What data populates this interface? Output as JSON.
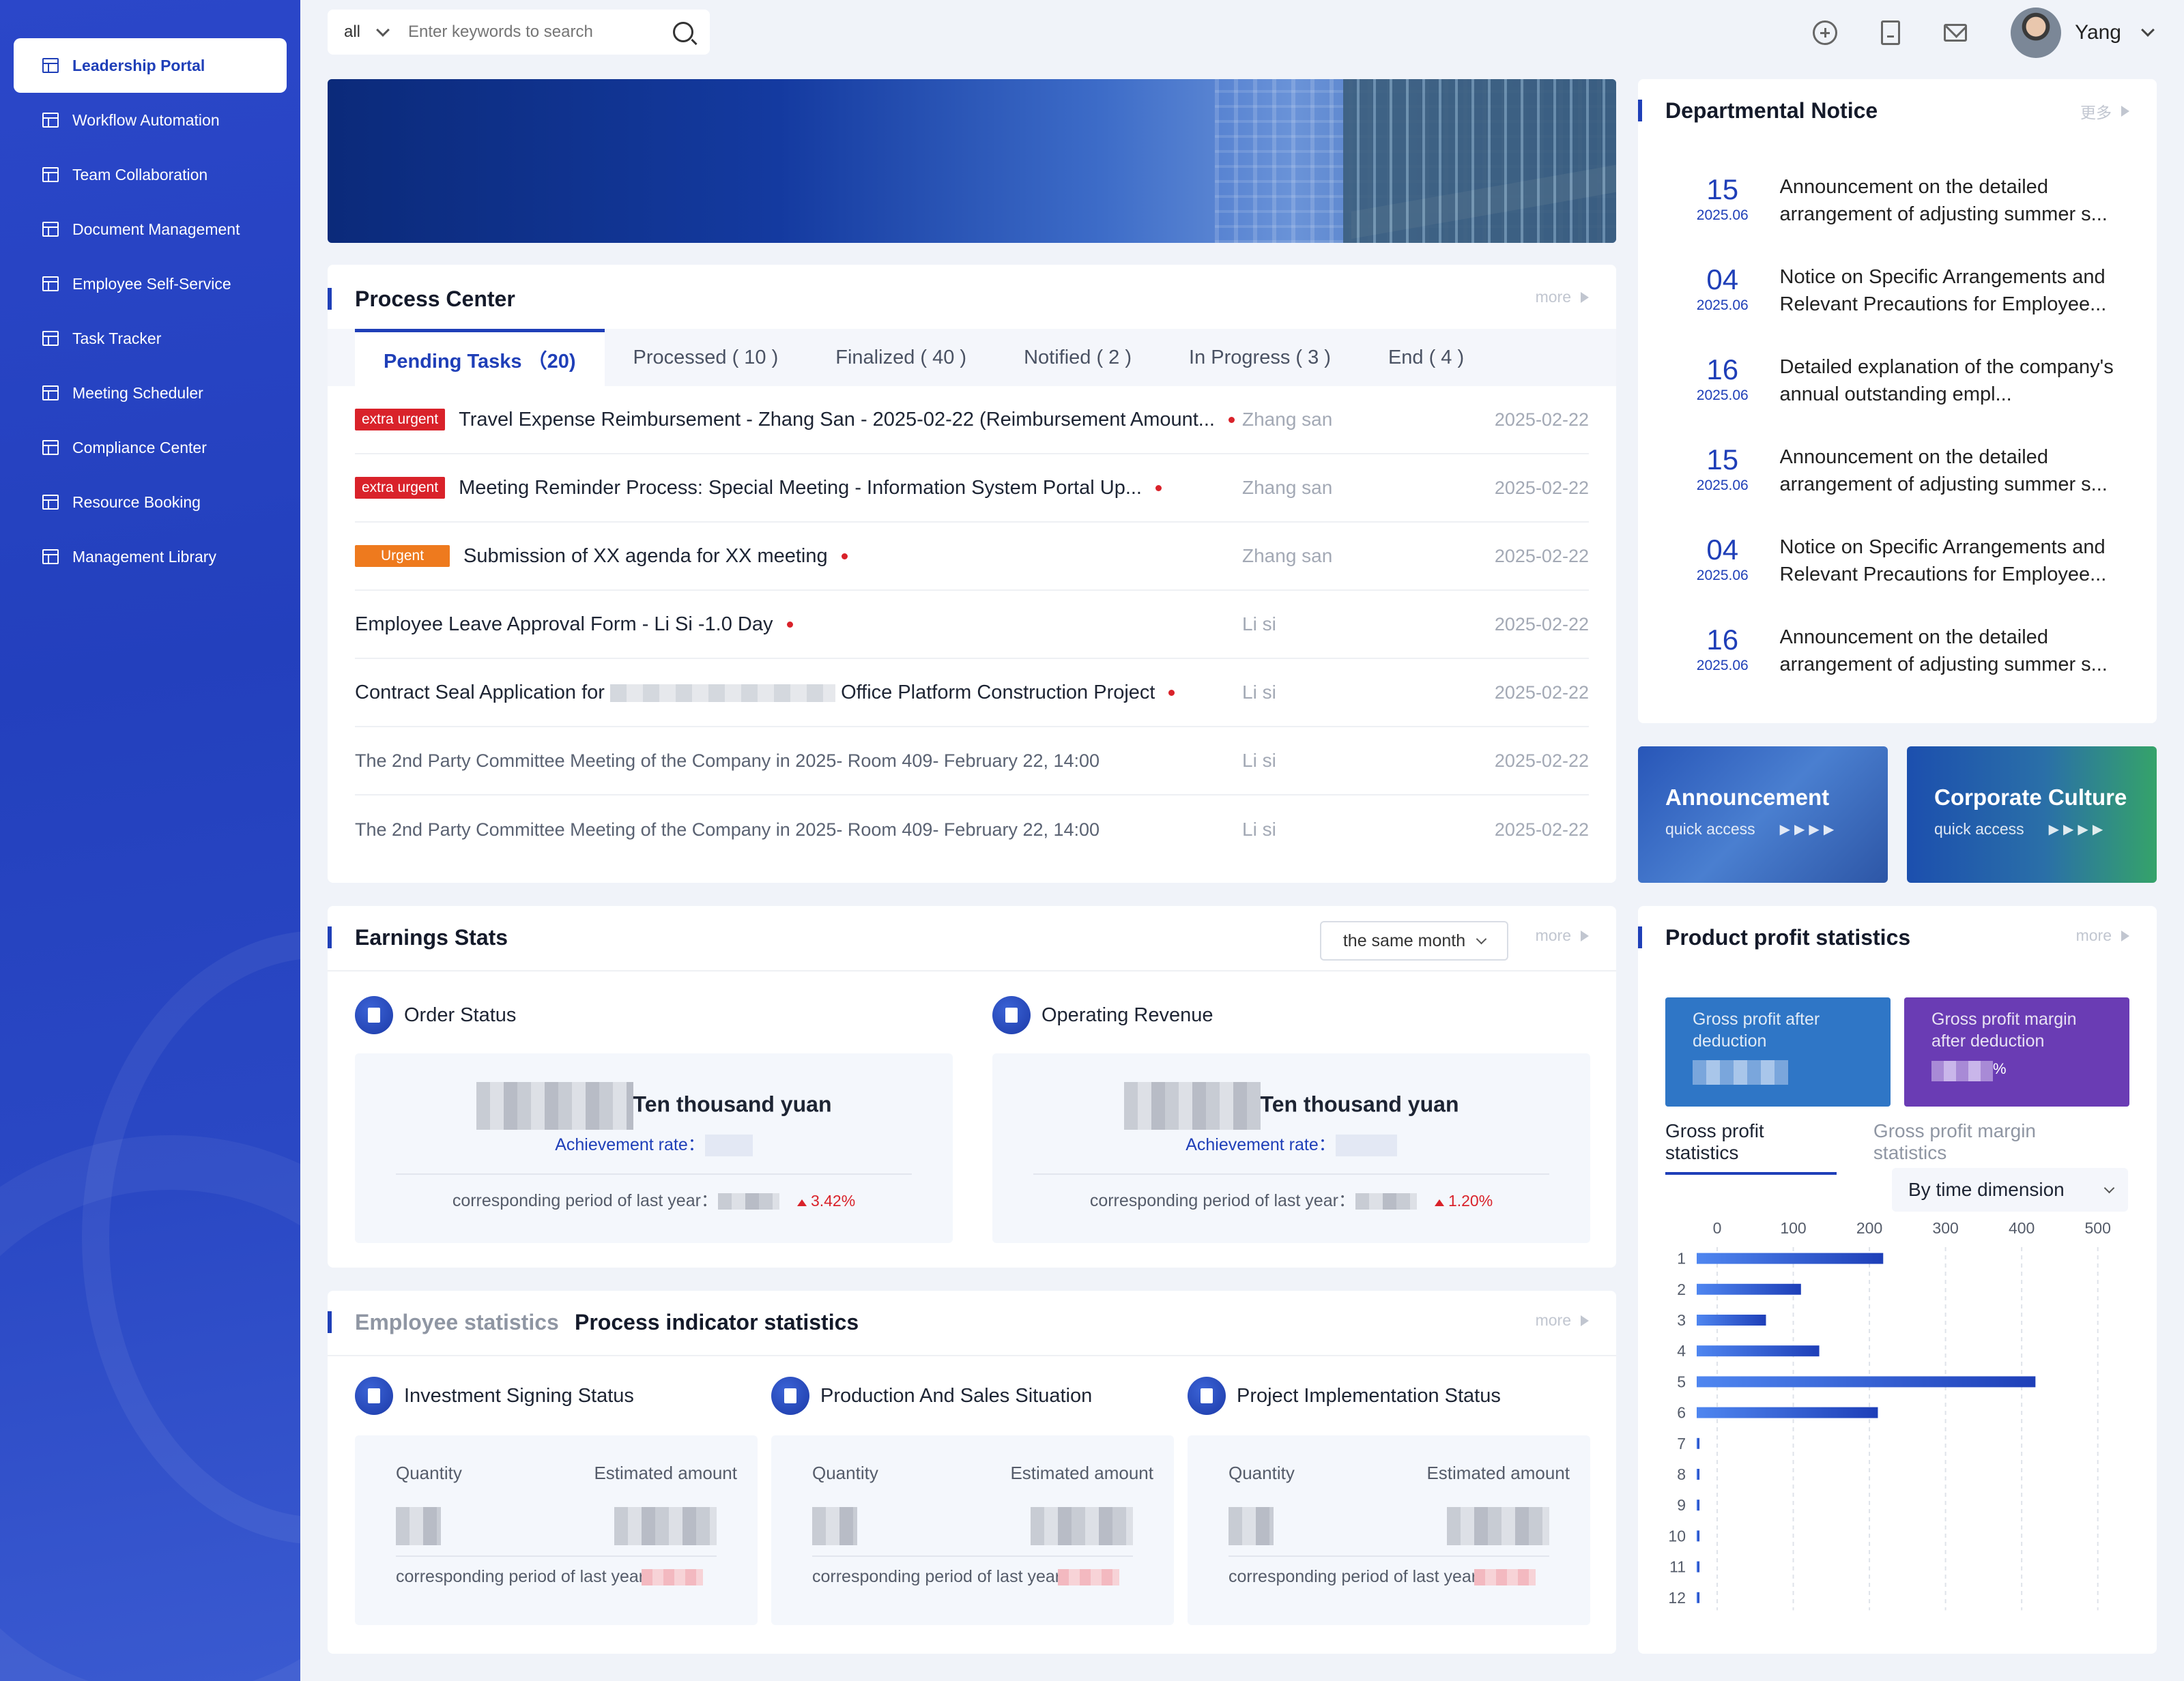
{
  "sidebar": {
    "items": [
      {
        "label": "Leadership Portal",
        "active": true
      },
      {
        "label": "Workflow Automation"
      },
      {
        "label": "Team Collaboration"
      },
      {
        "label": "Document Management"
      },
      {
        "label": "Employee Self-Service"
      },
      {
        "label": "Task Tracker"
      },
      {
        "label": "Meeting Scheduler"
      },
      {
        "label": "Compliance Center"
      },
      {
        "label": "Resource Booking"
      },
      {
        "label": "Management Library"
      }
    ]
  },
  "search": {
    "scope": "all",
    "placeholder": "Enter keywords to search"
  },
  "user": {
    "name": "Yang"
  },
  "icons": {
    "add": "plus-circle-icon",
    "document": "document-icon",
    "mail": "mail-icon",
    "search": "search-icon"
  },
  "process_center": {
    "title": "Process Center",
    "more": "more",
    "tabs": [
      {
        "label": "Pending Tasks （20)",
        "active": true
      },
      {
        "label": "Processed ( 10 )"
      },
      {
        "label": "Finalized ( 40 )"
      },
      {
        "label": "Notified ( 2 )"
      },
      {
        "label": "In Progress ( 3 )"
      },
      {
        "label": "End ( 4 )"
      }
    ],
    "tasks": [
      {
        "badge": "extra urgent",
        "badge_color": "#d9222a",
        "title": "Travel Expense Reimbursement - Zhang San - 2025-02-22 (Reimbursement Amount...",
        "dot": true,
        "user": "Zhang san",
        "date": "2025-02-22"
      },
      {
        "badge": "extra urgent",
        "badge_color": "#d9222a",
        "title": "Meeting Reminder Process: Special Meeting - Information System Portal Up...",
        "dot": true,
        "user": "Zhang san",
        "date": "2025-02-22"
      },
      {
        "badge": "Urgent",
        "badge_color": "#ee7a1e",
        "title": "Submission of XX agenda for XX meeting",
        "dot": true,
        "user": "Zhang san",
        "date": "2025-02-22"
      },
      {
        "badge": "",
        "title": "Employee Leave Approval Form - Li Si -1.0 Day",
        "dot": true,
        "user": "Li si",
        "date": "2025-02-22"
      },
      {
        "badge": "",
        "title_a": "Contract Seal Application for",
        "title_b": "Office Platform Construction Project",
        "dot": true,
        "user": "Li si",
        "date": "2025-02-22"
      },
      {
        "badge": "",
        "title": "The 2nd Party Committee Meeting of the Company in 2025- Room 409- February 22, 14:00",
        "dot": false,
        "user": "Li si",
        "date": "2025-02-22"
      },
      {
        "badge": "",
        "title": "The 2nd Party Committee Meeting of the Company in 2025- Room 409- February 22, 14:00",
        "dot": false,
        "user": "Li si",
        "date": "2025-02-22"
      }
    ]
  },
  "notice": {
    "title": "Departmental Notice",
    "more": "更多",
    "items": [
      {
        "day": "15",
        "ym": "2025.06",
        "text": "Announcement on the detailed arrangement of adjusting summer s..."
      },
      {
        "day": "04",
        "ym": "2025.06",
        "text": "Notice on Specific Arrangements and Relevant Precautions for Employee..."
      },
      {
        "day": "16",
        "ym": "2025.06",
        "text": "Detailed explanation of the company's annual outstanding empl..."
      },
      {
        "day": "15",
        "ym": "2025.06",
        "text": "Announcement on the detailed arrangement of adjusting summer s..."
      },
      {
        "day": "04",
        "ym": "2025.06",
        "text": "Notice on Specific Arrangements and Relevant Precautions for Employee..."
      },
      {
        "day": "16",
        "ym": "2025.06",
        "text": "Announcement on the detailed arrangement of adjusting summer s..."
      }
    ]
  },
  "quick": [
    {
      "title": "Announcement",
      "sub": "quick access"
    },
    {
      "title": "Corporate Culture",
      "sub": "quick access"
    }
  ],
  "earnings": {
    "title": "Earnings Stats",
    "dropdown": "the same month",
    "more": "more",
    "order": {
      "label": "Order Status",
      "unit": "Ten thousand yuan",
      "rate_label": "Achievement rate：",
      "prev_label": "corresponding period of last year：",
      "change": "3.42%"
    },
    "revenue": {
      "label": "Operating Revenue",
      "unit": "Ten thousand yuan",
      "rate_label": "Achievement rate：",
      "prev_label": "corresponding period of last year：",
      "change": "1.20%"
    }
  },
  "indicators": {
    "tab_inactive": "Employee statistics",
    "tab_active": "Process indicator statistics",
    "more": "more",
    "columns": [
      {
        "title": "Investment Signing Status",
        "q": "Quantity",
        "a": "Estimated amount",
        "prev": "corresponding period of last year："
      },
      {
        "title": "Production And Sales Situation",
        "q": "Quantity",
        "a": "Estimated amount",
        "prev": "corresponding period of last year："
      },
      {
        "title": "Project Implementation Status",
        "q": "Quantity",
        "a": "Estimated amount",
        "prev": "corresponding period of last year："
      }
    ]
  },
  "profit": {
    "title": "Product profit statistics",
    "more": "more",
    "card1": "Gross profit after deduction",
    "card2": "Gross profit margin after deduction",
    "card2_suffix": "%",
    "tabs": [
      "Gross profit statistics",
      "Gross profit margin statistics"
    ],
    "dimension": "By time dimension"
  },
  "chart_data": {
    "type": "bar",
    "orientation": "horizontal",
    "categories": [
      "1",
      "2",
      "3",
      "4",
      "5",
      "6",
      "7",
      "8",
      "9",
      "10",
      "11",
      "12"
    ],
    "values": [
      245,
      137,
      91,
      161,
      445,
      238,
      3,
      3,
      3,
      3,
      3,
      3
    ],
    "xticks": [
      0,
      100,
      200,
      300,
      400,
      500
    ],
    "xlim": [
      0,
      520
    ],
    "grid": true,
    "bar_color": "#2f5fe0"
  }
}
